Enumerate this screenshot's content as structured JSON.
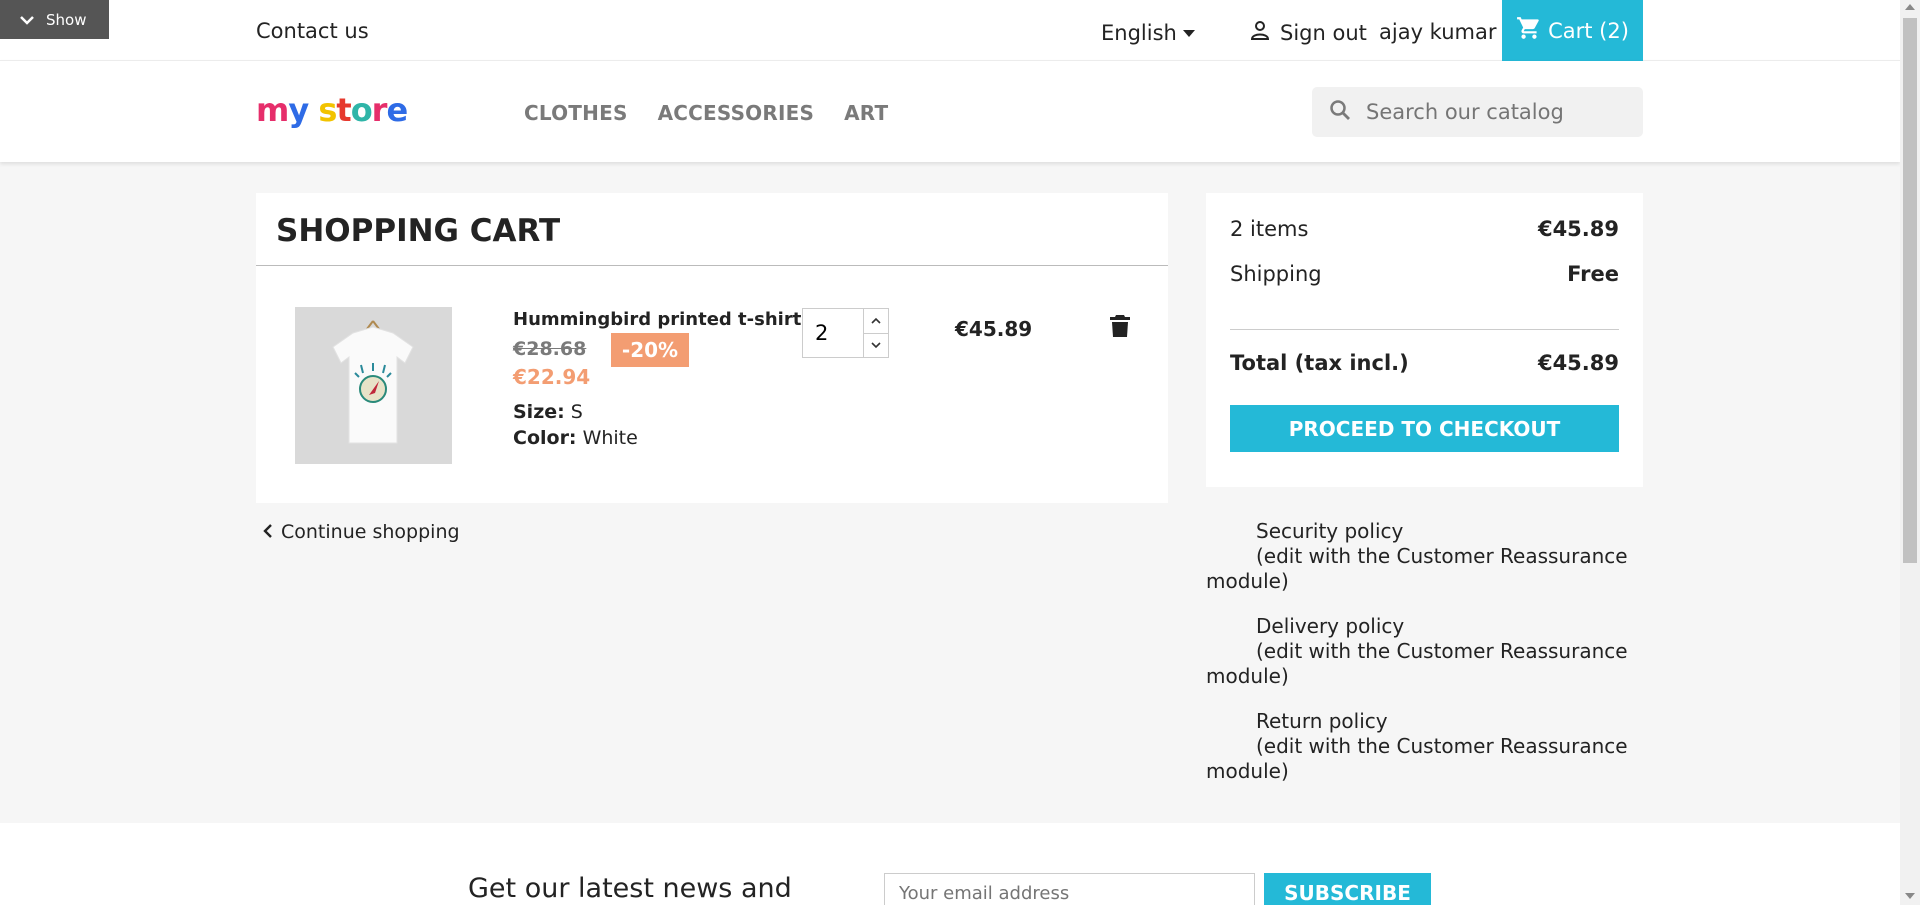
{
  "toggle": {
    "label": "Show"
  },
  "topbar": {
    "contact": "Contact us",
    "language": "English",
    "signout": "Sign out",
    "username": "ajay kumar",
    "cart": "Cart (2)"
  },
  "header": {
    "logo_letters": [
      "m",
      "y",
      " ",
      "s",
      "t",
      "o",
      "r",
      "e"
    ],
    "nav": [
      "CLOTHES",
      "ACCESSORIES",
      "ART"
    ],
    "search_placeholder": "Search our catalog"
  },
  "cart": {
    "title": "SHOPPING CART",
    "item": {
      "name": "Hummingbird printed t-shirt",
      "old_price": "€28.68",
      "discount": "-20%",
      "price": "€22.94",
      "size_label": "Size:",
      "size": "S",
      "color_label": "Color:",
      "color": "White",
      "quantity": "2",
      "total": "€45.89"
    },
    "continue": "Continue shopping"
  },
  "summary": {
    "items_label": "2 items",
    "items_value": "€45.89",
    "shipping_label": "Shipping",
    "shipping_value": "Free",
    "total_label": "Total (tax incl.)",
    "total_value": "€45.89",
    "checkout": "PROCEED TO CHECKOUT"
  },
  "reassurance": [
    {
      "title": "Security policy",
      "note": "(edit with the Customer Reassurance",
      "note2": "module)"
    },
    {
      "title": "Delivery policy",
      "note": "(edit with the Customer Reassurance",
      "note2": "module)"
    },
    {
      "title": "Return policy",
      "note": "(edit with the Customer Reassurance",
      "note2": "module)"
    }
  ],
  "footer": {
    "newsletter": "Get our latest news and",
    "email_placeholder": "Your email address",
    "subscribe": "SUBSCRIBE"
  },
  "colors": {
    "accent": "#24b9d7",
    "discount": "#f39d72"
  }
}
